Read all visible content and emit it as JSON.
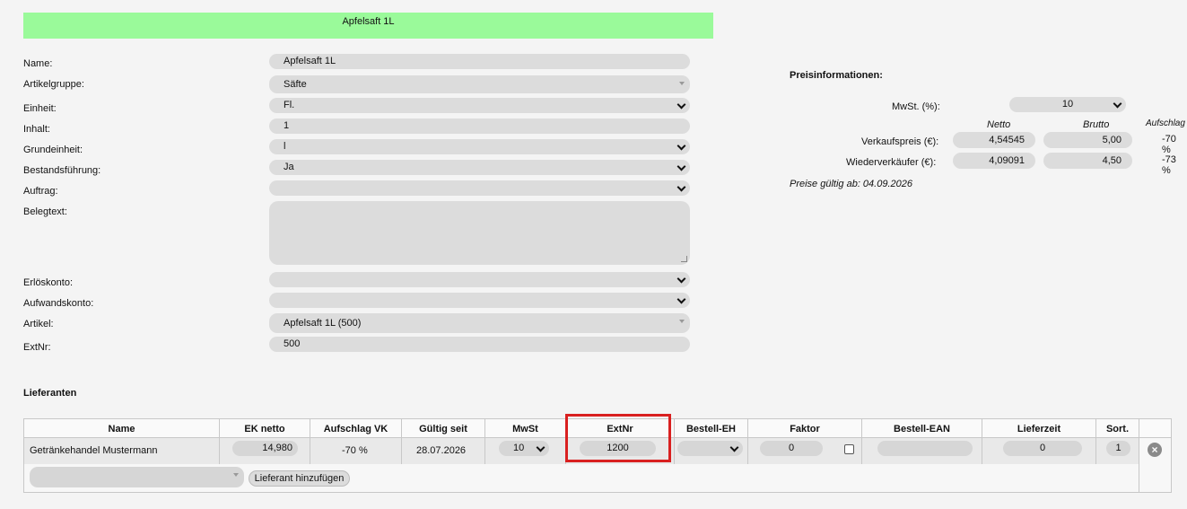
{
  "banner_title": "Apfelsaft 1L",
  "form": {
    "fields": [
      {
        "label": "Name:",
        "value": "Apfelsaft 1L"
      },
      {
        "label": "Artikelgruppe:",
        "value": "Säfte"
      },
      {
        "label": "Einheit:",
        "value": "Fl."
      },
      {
        "label": "Inhalt:",
        "value": "1"
      },
      {
        "label": "Grundeinheit:",
        "value": "l"
      },
      {
        "label": "Bestandsführung:",
        "value": "Ja"
      },
      {
        "label": "Auftrag:",
        "value": ""
      },
      {
        "label": "Belegtext:",
        "value": ""
      },
      {
        "label": "Erlöskonto:",
        "value": ""
      },
      {
        "label": "Aufwandskonto:",
        "value": ""
      },
      {
        "label": "Artikel:",
        "value": "Apfelsaft 1L (500)"
      },
      {
        "label": "ExtNr:",
        "value": "500"
      }
    ]
  },
  "price": {
    "heading": "Preisinformationen:",
    "mwst_label": "MwSt. (%):",
    "mwst_value": "10",
    "col_netto": "Netto",
    "col_brutto": "Brutto",
    "col_aufschlag": "Aufschlag",
    "rows": [
      {
        "label": "Verkaufspreis (€):",
        "netto": "4,54545",
        "brutto": "5,00",
        "aufschlag": "-70 %"
      },
      {
        "label": "Wiederverkäufer (€):",
        "netto": "4,09091",
        "brutto": "4,50",
        "aufschlag": "-73 %"
      }
    ],
    "valid_from": "Preise gültig ab: 04.09.2026"
  },
  "suppliers": {
    "heading": "Lieferanten",
    "columns": [
      "Name",
      "EK netto",
      "Aufschlag VK",
      "Gültig seit",
      "MwSt",
      "ExtNr",
      "Bestell-EH",
      "Faktor",
      "Bestell-EAN",
      "Lieferzeit",
      "Sort."
    ],
    "row": {
      "name": "Getränkehandel Mustermann",
      "ek_netto": "14,980",
      "aufschlag_vk": "-70 %",
      "gueltig_seit": "28.07.2026",
      "mwst": "10",
      "extnr": "1200",
      "bestell_eh": "",
      "faktor": "0",
      "bestell_ean": "",
      "lieferzeit": "0",
      "sort": "1"
    },
    "add_button": "Lieferant hinzufügen",
    "highlight_color": "#d92020"
  }
}
